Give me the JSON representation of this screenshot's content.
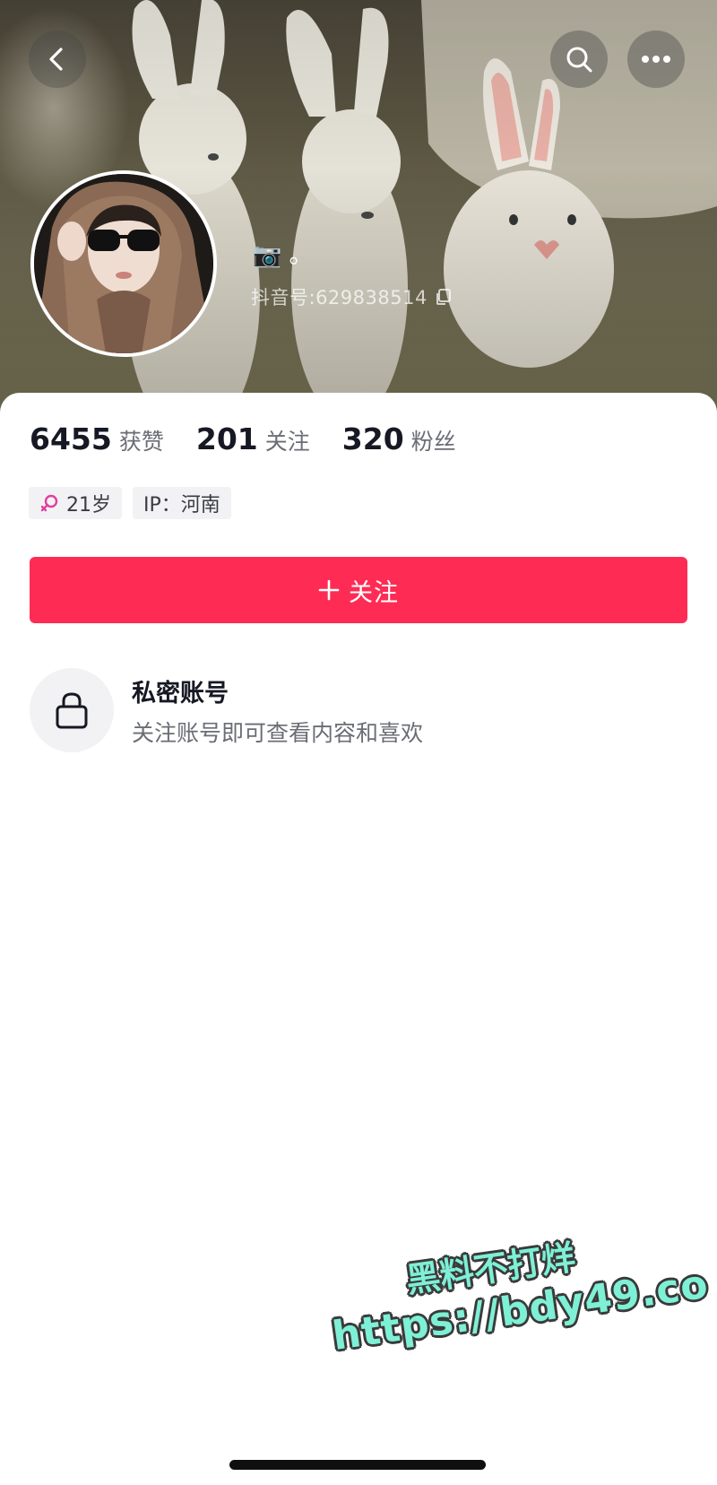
{
  "profile": {
    "nickname": "📷 。",
    "douyin_id": "抖音号:629838514"
  },
  "stats": [
    {
      "value": "6455",
      "label": "获赞"
    },
    {
      "value": "201",
      "label": "关注"
    },
    {
      "value": "320",
      "label": "粉丝"
    }
  ],
  "tags": {
    "age": "21岁",
    "gender_icon": "female-icon",
    "ip": "IP：河南"
  },
  "follow_button": {
    "label": "关注",
    "icon": "plus-icon"
  },
  "private_account": {
    "icon": "lock-icon",
    "title": "私密账号",
    "description": "关注账号即可查看内容和喜欢"
  },
  "watermark": {
    "line1": "黑料不打烊",
    "line2": "https://bdy49.co"
  },
  "colors": {
    "accent": "#fe2c55",
    "gender_pink": "#e040a0"
  }
}
